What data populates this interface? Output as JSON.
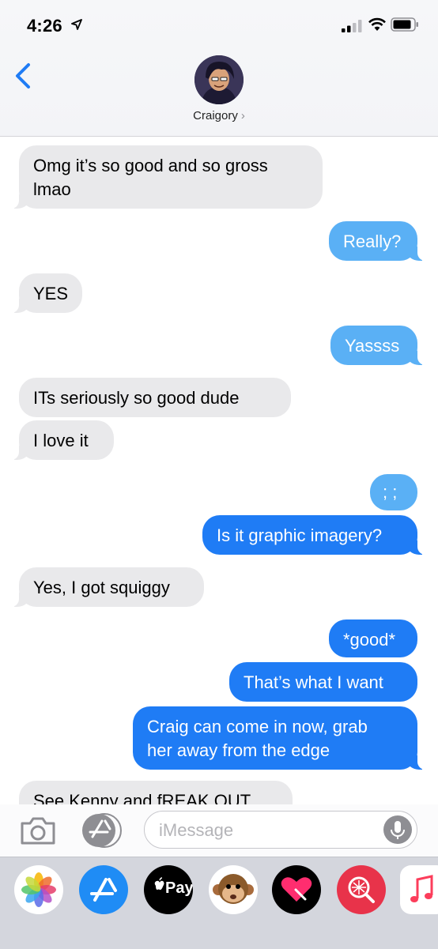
{
  "status_bar": {
    "time": "4:26"
  },
  "header": {
    "contact_name": "Craigory",
    "chevron": "›"
  },
  "messages": [
    {
      "from": "them",
      "text_lines": [
        "Omg it’s so good and so gross",
        "lmao"
      ]
    },
    {
      "from": "me",
      "text": "Really?"
    },
    {
      "from": "them",
      "text": "YES"
    },
    {
      "from": "me",
      "text": "Yassss"
    },
    {
      "from": "them",
      "text": "ITs seriously so good dude"
    },
    {
      "from": "them",
      "text": "I love it"
    },
    {
      "from": "me",
      "text": "; ;"
    },
    {
      "from": "me",
      "text": "Is it graphic imagery?"
    },
    {
      "from": "them",
      "text": "Yes, I got squiggy"
    },
    {
      "from": "me",
      "text": "*good*"
    },
    {
      "from": "me",
      "text": "That’s what I want"
    },
    {
      "from": "me",
      "text_lines": [
        "Craig can come in now, grab",
        "her away from the edge"
      ]
    },
    {
      "from": "them",
      "text": "See Kenny and fREAK OUT"
    }
  ],
  "input": {
    "placeholder": "iMessage"
  },
  "drawer": {
    "apps": [
      {
        "name": "photos-app-icon"
      },
      {
        "name": "app-store-icon"
      },
      {
        "name": "apple-pay-icon",
        "label": "Pay"
      },
      {
        "name": "animoji-icon"
      },
      {
        "name": "digital-touch-icon"
      },
      {
        "name": "search-images-icon"
      },
      {
        "name": "music-icon"
      }
    ]
  },
  "colors": {
    "incoming_bubble": "#e9e9eb",
    "outgoing_bubble": "#1f7cf5",
    "outgoing_bubble_light": "#5ab0f5",
    "ios_blue": "#1f7cf5"
  }
}
